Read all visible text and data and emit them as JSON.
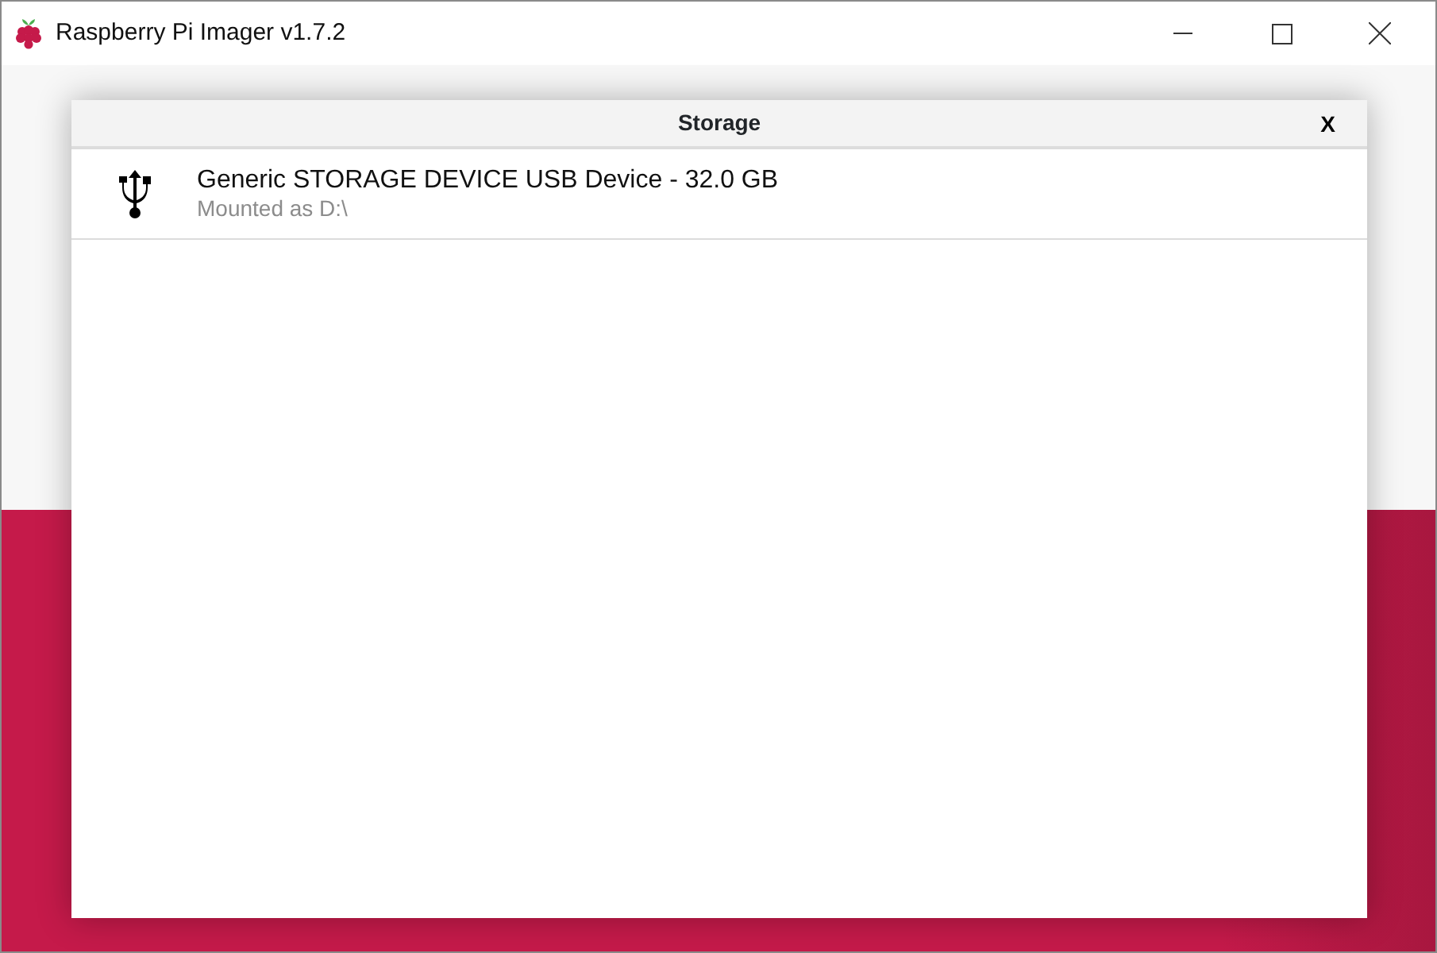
{
  "window": {
    "title": "Raspberry Pi Imager v1.7.2"
  },
  "dialog": {
    "title": "Storage",
    "close": "X",
    "items": [
      {
        "name": "Generic STORAGE DEVICE USB Device - 32.0 GB",
        "detail": "Mounted as D:\\"
      }
    ]
  }
}
